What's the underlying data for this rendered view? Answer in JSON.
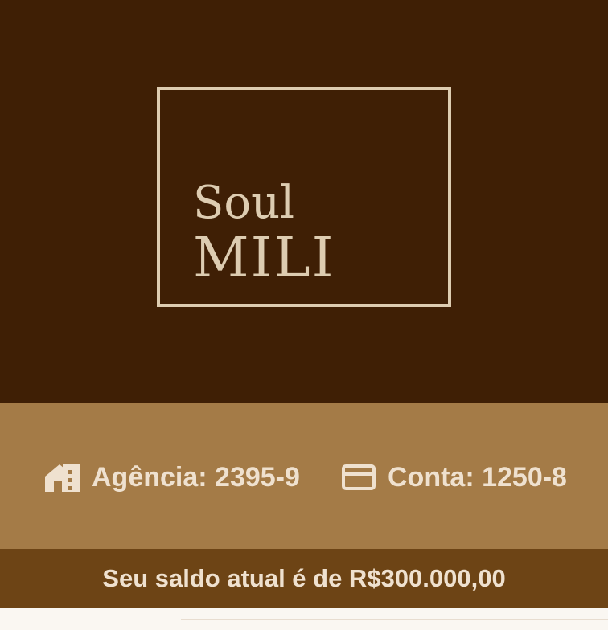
{
  "brand": {
    "line1": "Soul",
    "line2": "MILI"
  },
  "account": {
    "agency_text": "Agência: 2395-9",
    "account_text": "Conta: 1250-8",
    "agency_icon": "house-icon",
    "account_icon": "credit-card-icon"
  },
  "balance": {
    "text": "Seu saldo atual é de R$300.000,00"
  },
  "colors": {
    "header_background": "#3f1f05",
    "logo_frame": "#ddccb1",
    "account_band": "#a47b47",
    "balance_band": "#6d4415",
    "text_light": "#efe1cf"
  }
}
